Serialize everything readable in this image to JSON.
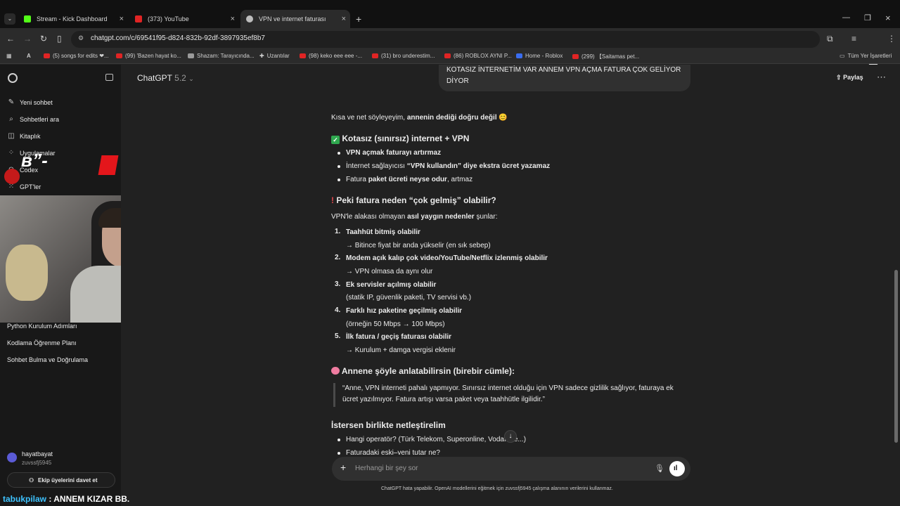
{
  "browser": {
    "tabs": [
      {
        "title": "Stream - Kick Dashboard"
      },
      {
        "title": "(373) YouTube"
      },
      {
        "title": "VPN ve internet faturası"
      }
    ],
    "url": "chatgpt.com/c/69541f95-d824-832b-92df-3897935ef8b7",
    "bookmarks": [
      "(5) songs for edits ❤...",
      "(99) 'Bazen hayat ko...",
      "Shazam: Tarayıcında...",
      "Uzantılar",
      "(98) keko eee eee -...",
      "(31) bro underestim...",
      "(86) ROBLOX AYNI P...",
      "Home - Roblox",
      "(299) 【Saitamas pet..."
    ],
    "all_bookmarks": "Tüm Yer İşaretleri"
  },
  "sidebar": {
    "items": [
      {
        "label": "Yeni sohbet",
        "icon": "edit-icon"
      },
      {
        "label": "Sohbetleri ara",
        "icon": "search-icon"
      },
      {
        "label": "Kitaplık",
        "icon": "library-icon"
      },
      {
        "label": "Uygulamalar",
        "icon": "apps-icon"
      },
      {
        "label": "Codex",
        "icon": "codex-icon"
      },
      {
        "label": "GPT'ler",
        "icon": "gpts-icon"
      }
    ],
    "chats": [
      "Python Kurulum Adımları",
      "Kodlama Öğrenme Planı",
      "Sohbet Bulma ve Doğrulama"
    ],
    "user": {
      "name": "hayatbayat",
      "workspace": "zuvssfj5945"
    },
    "invite": "Ekip üyelerini davet et"
  },
  "header": {
    "model": "ChatGPT",
    "version": "5.2",
    "share": "Paylaş"
  },
  "conversation": {
    "user_message_line1": "KOTASIZ İNTERNETİM VAR ANNEM VPN AÇMA FATURA ÇOK GELİYOR",
    "user_message_line2": "DİYOR",
    "intro_plain": "Kısa ve net söyleyeyim, ",
    "intro_bold": "annenin dediği doğru değil",
    "intro_emoji": "😊",
    "s1_heading": "Kotasız (sınırsız) internet + VPN",
    "s1_b1": "VPN açmak faturayı artırmaz",
    "s1_b2_a": "İnternet sağlayıcısı ",
    "s1_b2_b": "“VPN kullandın” diye ekstra ücret yazamaz",
    "s1_b3_a": "Fatura ",
    "s1_b3_b": "paket ücreti neyse odur",
    "s1_b3_c": ", artmaz",
    "s2_heading": "Peki fatura neden “çok gelmiş” olabilir?",
    "s2_intro_a": "VPN'le alakası olmayan ",
    "s2_intro_b": "asıl yaygın nedenler",
    "s2_intro_c": " şunlar:",
    "reasons": [
      {
        "n": "1.",
        "title": "Taahhüt bitmiş olabilir",
        "detail": "→ Bitince fiyat bir anda yükselir (en sık sebep)"
      },
      {
        "n": "2.",
        "title": "Modem açık kalıp çok video/YouTube/Netflix izlenmiş olabilir",
        "detail": "→ VPN olmasa da aynı olur"
      },
      {
        "n": "3.",
        "title": "Ek servisler açılmış olabilir",
        "detail": "(statik IP, güvenlik paketi, TV servisi vb.)"
      },
      {
        "n": "4.",
        "title": "Farklı hız paketine geçilmiş olabilir",
        "detail": "(örneğin 50 Mbps → 100 Mbps)"
      },
      {
        "n": "5.",
        "title": "İlk fatura / geçiş faturası olabilir",
        "detail": "→ Kurulum + damga vergisi eklenir"
      }
    ],
    "s3_heading": "Annene şöyle anlatabilirsin (birebir cümle):",
    "quote_line1": "“Anne, VPN interneti pahalı yapmıyor. Sınırsız internet olduğu için VPN sadece gizlilik sağlıyor, faturaya ek",
    "quote_line2": "ücret yazılmıyor. Fatura artışı varsa paket veya taahhütle ilgilidir.”",
    "s4_heading": "İstersen birlikte netleştirelim",
    "s4_b1": "Hangi operatör? (Türk Telekom, Superonline, Vodafone...)",
    "s4_b2": "Faturadaki eski–yeni tutar ne?"
  },
  "composer": {
    "placeholder": "Herhangi bir şey sor",
    "disclaimer": "ChatGPT hata yapabilir. OpenAI modellerini eğitmek için zuvssfj5945 çalışma alanının verilerini kullanmaz."
  },
  "overlay": {
    "stream_chat_user": "tabukpilaw",
    "stream_chat_msg": " : ANNEM KIZAR BB."
  },
  "colors": {
    "accent_green": "#2fa84f",
    "kick_green": "#53fc18",
    "youtube_red": "#e02424"
  }
}
